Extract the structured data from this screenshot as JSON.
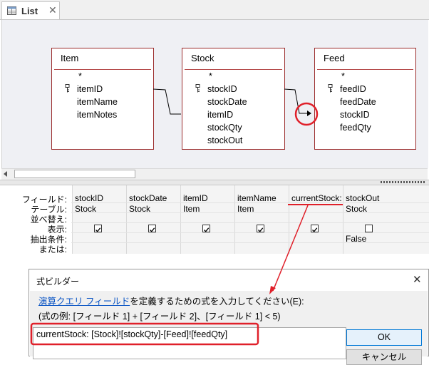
{
  "tab": {
    "title": "List",
    "close": "✕",
    "icon": "query-table-icon"
  },
  "tables": [
    {
      "name": "Item",
      "star": "*",
      "fields": [
        "itemID",
        "itemName",
        "itemNotes"
      ],
      "key_field": "itemID"
    },
    {
      "name": "Stock",
      "star": "*",
      "fields": [
        "stockID",
        "stockDate",
        "itemID",
        "stockQty",
        "stockOut"
      ],
      "key_field": "stockID"
    },
    {
      "name": "Feed",
      "star": "*",
      "fields": [
        "feedID",
        "feedDate",
        "stockID",
        "feedQty"
      ],
      "key_field": "feedID"
    }
  ],
  "grid": {
    "row_labels": [
      "フィールド:",
      "テーブル:",
      "並べ替え:",
      "表示:",
      "抽出条件:",
      "または:"
    ],
    "columns": [
      {
        "field": "stockID",
        "table": "Stock",
        "show": true,
        "criteria": ""
      },
      {
        "field": "stockDate",
        "table": "Stock",
        "show": true,
        "criteria": ""
      },
      {
        "field": "itemID",
        "table": "Item",
        "show": true,
        "criteria": ""
      },
      {
        "field": "itemName",
        "table": "Item",
        "show": true,
        "criteria": ""
      },
      {
        "field": "currentStock:",
        "table": "",
        "show": true,
        "criteria": ""
      },
      {
        "field": "stockOut",
        "table": "Stock",
        "show": false,
        "criteria": "False"
      }
    ]
  },
  "dialog": {
    "title": "式ビルダー",
    "close": "✕",
    "instruction_link": "演算クエリ フィールド",
    "instruction_rest": "を定義するための式を入力してください(E):",
    "example": "(式の例: [フィールド 1] + [フィールド 2]、[フィールド 1] < 5)",
    "expression": "currentStock: [Stock]![stockQty]-[Feed]![feedQty]",
    "ok_label": "OK",
    "cancel_label": "キャンセル"
  },
  "colors": {
    "annotation": "#e0202a",
    "table_border": "#9b2c2c",
    "link": "#0b55c4"
  }
}
